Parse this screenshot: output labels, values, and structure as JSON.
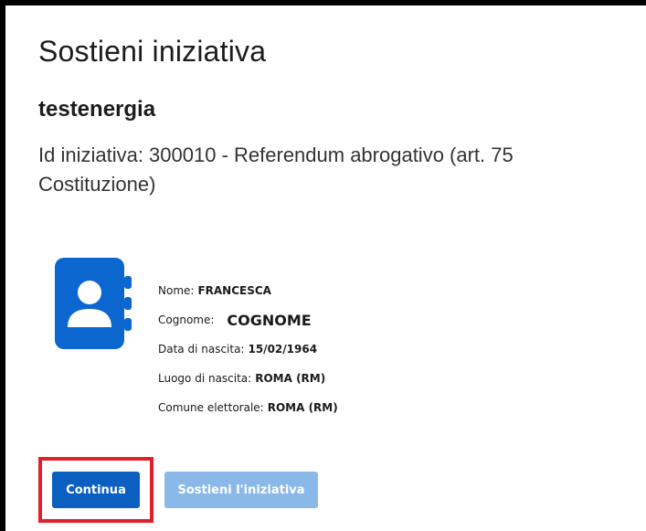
{
  "page": {
    "title": "Sostieni iniziativa",
    "subtitle": "testenergia",
    "iniziativa_text": "Id iniziativa: 300010 - Referendum abrogativo (art. 75 Costituzione)"
  },
  "person": {
    "icon": "contact-book-icon",
    "fields": [
      {
        "label": "Nome:",
        "value": "FRANCESCA"
      },
      {
        "label": "Cognome:",
        "value": "COGNOME"
      },
      {
        "label": "Data di nascita:",
        "value": "15/02/1964"
      },
      {
        "label": "Luogo di nascita:",
        "value": "ROMA (RM)"
      },
      {
        "label": "Comune elettorale:",
        "value": "ROMA (RM)"
      }
    ]
  },
  "actions": {
    "continue_label": "Continua",
    "support_label": "Sostieni l'iniziativa"
  },
  "colors": {
    "primary": "#0b5fc0",
    "disabled": "#8ab8e8",
    "highlight": "#e0202a",
    "icon": "#0b66d0"
  }
}
